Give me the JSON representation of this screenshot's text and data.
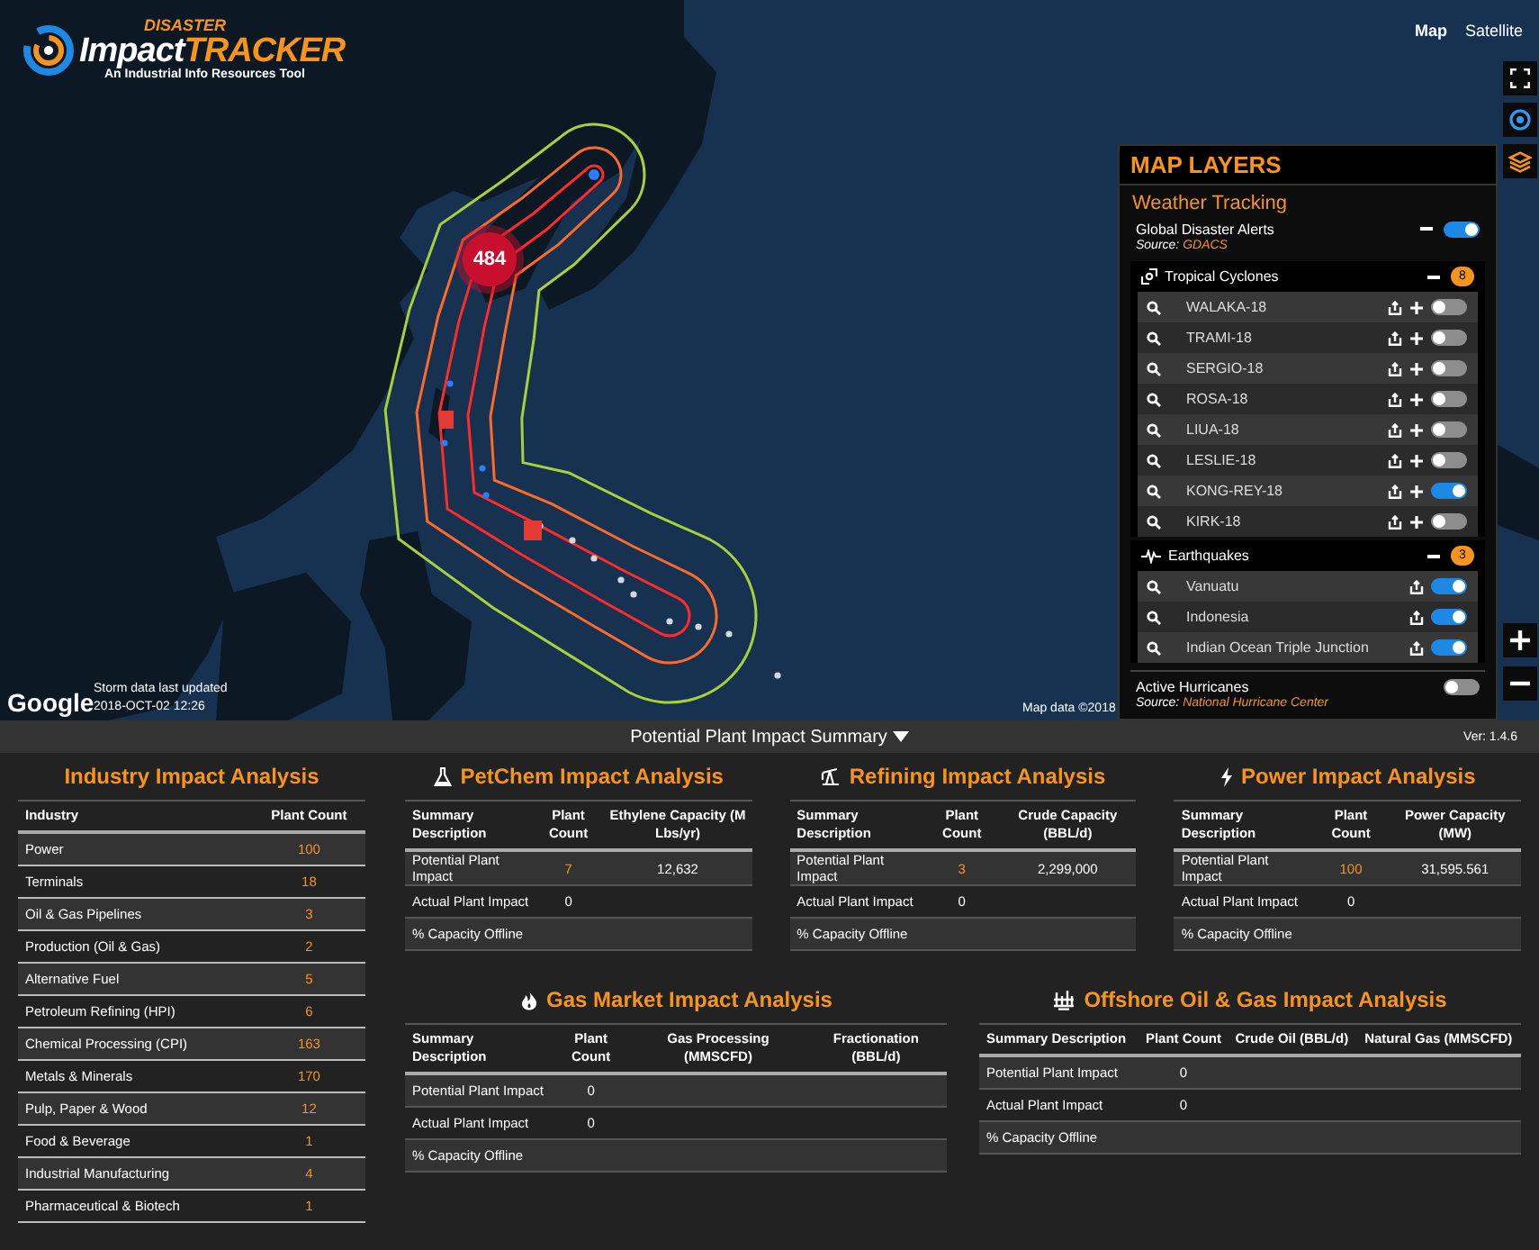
{
  "header": {
    "logo_top": "DISASTER",
    "logo_left": "Impact",
    "logo_right": "TRACKER",
    "tagline": "An Industrial Info Resources Tool"
  },
  "map": {
    "types": [
      {
        "label": "Map",
        "selected": true
      },
      {
        "label": "Satellite",
        "selected": false
      }
    ],
    "cluster": "484",
    "google": "Google",
    "updated_label": "Storm data last updated",
    "updated_time": "2018-OCT-02 12:26",
    "attribution": "Map data ©2018"
  },
  "layers": {
    "title": "MAP LAYERS",
    "section": "Weather Tracking",
    "global": {
      "label": "Global Disaster Alerts",
      "on": true,
      "source_label": "Source:",
      "source": "GDACS"
    },
    "groups": [
      {
        "kind": "cyclones",
        "name": "Tropical Cyclones",
        "count": "8",
        "items": [
          {
            "name": "WALAKA-18",
            "on": false
          },
          {
            "name": "TRAMI-18",
            "on": false
          },
          {
            "name": "SERGIO-18",
            "on": false
          },
          {
            "name": "ROSA-18",
            "on": false
          },
          {
            "name": "LIUA-18",
            "on": false
          },
          {
            "name": "LESLIE-18",
            "on": false
          },
          {
            "name": "KONG-REY-18",
            "on": true
          },
          {
            "name": "KIRK-18",
            "on": false
          }
        ]
      },
      {
        "kind": "earthquakes",
        "name": "Earthquakes",
        "count": "3",
        "items": [
          {
            "name": "Vanuatu",
            "on": true
          },
          {
            "name": "Indonesia",
            "on": true
          },
          {
            "name": "Indian Ocean Triple Junction",
            "on": true
          }
        ]
      }
    ],
    "hurricanes": {
      "label": "Active Hurricanes",
      "on": false,
      "source_label": "Source:",
      "source": "National Hurricane Center"
    }
  },
  "summary_bar": {
    "title": "Potential Plant Impact Summary",
    "version": "Ver: 1.4.6"
  },
  "industry": {
    "title": "Industry Impact Analysis",
    "columns": [
      "Industry",
      "Plant Count"
    ],
    "rows": [
      {
        "name": "Power",
        "count": "100"
      },
      {
        "name": "Terminals",
        "count": "18"
      },
      {
        "name": "Oil & Gas Pipelines",
        "count": "3"
      },
      {
        "name": "Production (Oil & Gas)",
        "count": "2"
      },
      {
        "name": "Alternative Fuel",
        "count": "5"
      },
      {
        "name": "Petroleum Refining (HPI)",
        "count": "6"
      },
      {
        "name": "Chemical Processing (CPI)",
        "count": "163"
      },
      {
        "name": "Metals & Minerals",
        "count": "170"
      },
      {
        "name": "Pulp, Paper & Wood",
        "count": "12"
      },
      {
        "name": "Food & Beverage",
        "count": "1"
      },
      {
        "name": "Industrial Manufacturing",
        "count": "4"
      },
      {
        "name": "Pharmaceutical & Biotech",
        "count": "1"
      }
    ]
  },
  "analyses": [
    {
      "kind": "petchem",
      "title": "PetChem Impact Analysis",
      "columns": [
        "Summary Description",
        "Plant Count",
        "Ethylene Capacity (M Lbs/yr)"
      ],
      "rows": [
        {
          "cells": [
            "Potential Plant Impact",
            "7",
            "12,632"
          ],
          "accent": true
        },
        {
          "cells": [
            "Actual Plant Impact",
            "0",
            ""
          ],
          "accent": false
        },
        {
          "cells": [
            "% Capacity Offline",
            "",
            ""
          ]
        }
      ]
    },
    {
      "kind": "refining",
      "title": "Refining Impact Analysis",
      "columns": [
        "Summary Description",
        "Plant Count",
        "Crude Capacity (BBL/d)"
      ],
      "rows": [
        {
          "cells": [
            "Potential Plant Impact",
            "3",
            "2,299,000"
          ],
          "accent": true
        },
        {
          "cells": [
            "Actual Plant Impact",
            "0",
            ""
          ],
          "accent": false
        },
        {
          "cells": [
            "% Capacity Offline",
            "",
            ""
          ]
        }
      ]
    },
    {
      "kind": "power",
      "title": "Power Impact Analysis",
      "columns": [
        "Summary Description",
        "Plant Count",
        "Power Capacity (MW)"
      ],
      "rows": [
        {
          "cells": [
            "Potential Plant Impact",
            "100",
            "31,595.561"
          ],
          "accent": true
        },
        {
          "cells": [
            "Actual Plant Impact",
            "0",
            ""
          ],
          "accent": false
        },
        {
          "cells": [
            "% Capacity Offline",
            "",
            ""
          ]
        }
      ]
    },
    {
      "kind": "gas",
      "title": "Gas Market Impact Analysis",
      "columns": [
        "Summary Description",
        "Plant Count",
        "Gas Processing (MMSCFD)",
        "Fractionation (BBL/d)"
      ],
      "rows": [
        {
          "cells": [
            "Potential Plant Impact",
            "0",
            "",
            ""
          ],
          "accent": false
        },
        {
          "cells": [
            "Actual Plant Impact",
            "0",
            "",
            ""
          ],
          "accent": false
        },
        {
          "cells": [
            "% Capacity Offline",
            "",
            "",
            ""
          ]
        }
      ]
    },
    {
      "kind": "offshore",
      "title": "Offshore Oil & Gas Impact Analysis",
      "columns": [
        "Summary Description",
        "Plant Count",
        "Crude Oil (BBL/d)",
        "Natural Gas (MMSCFD)"
      ],
      "rows": [
        {
          "cells": [
            "Potential Plant Impact",
            "0",
            "",
            ""
          ],
          "accent": false
        },
        {
          "cells": [
            "Actual Plant Impact",
            "0",
            "",
            ""
          ],
          "accent": false
        },
        {
          "cells": [
            "% Capacity Offline",
            "",
            "",
            ""
          ]
        }
      ]
    }
  ]
}
